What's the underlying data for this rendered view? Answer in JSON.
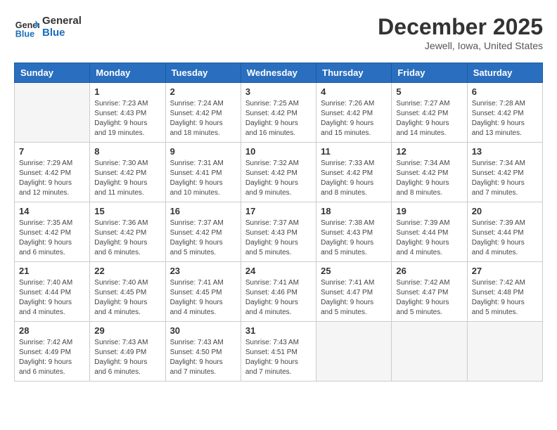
{
  "header": {
    "logo_line1": "General",
    "logo_line2": "Blue",
    "month_title": "December 2025",
    "location": "Jewell, Iowa, United States"
  },
  "weekdays": [
    "Sunday",
    "Monday",
    "Tuesday",
    "Wednesday",
    "Thursday",
    "Friday",
    "Saturday"
  ],
  "weeks": [
    [
      {
        "num": "",
        "info": ""
      },
      {
        "num": "1",
        "info": "Sunrise: 7:23 AM\nSunset: 4:43 PM\nDaylight: 9 hours\nand 19 minutes."
      },
      {
        "num": "2",
        "info": "Sunrise: 7:24 AM\nSunset: 4:42 PM\nDaylight: 9 hours\nand 18 minutes."
      },
      {
        "num": "3",
        "info": "Sunrise: 7:25 AM\nSunset: 4:42 PM\nDaylight: 9 hours\nand 16 minutes."
      },
      {
        "num": "4",
        "info": "Sunrise: 7:26 AM\nSunset: 4:42 PM\nDaylight: 9 hours\nand 15 minutes."
      },
      {
        "num": "5",
        "info": "Sunrise: 7:27 AM\nSunset: 4:42 PM\nDaylight: 9 hours\nand 14 minutes."
      },
      {
        "num": "6",
        "info": "Sunrise: 7:28 AM\nSunset: 4:42 PM\nDaylight: 9 hours\nand 13 minutes."
      }
    ],
    [
      {
        "num": "7",
        "info": "Sunrise: 7:29 AM\nSunset: 4:42 PM\nDaylight: 9 hours\nand 12 minutes."
      },
      {
        "num": "8",
        "info": "Sunrise: 7:30 AM\nSunset: 4:42 PM\nDaylight: 9 hours\nand 11 minutes."
      },
      {
        "num": "9",
        "info": "Sunrise: 7:31 AM\nSunset: 4:41 PM\nDaylight: 9 hours\nand 10 minutes."
      },
      {
        "num": "10",
        "info": "Sunrise: 7:32 AM\nSunset: 4:42 PM\nDaylight: 9 hours\nand 9 minutes."
      },
      {
        "num": "11",
        "info": "Sunrise: 7:33 AM\nSunset: 4:42 PM\nDaylight: 9 hours\nand 8 minutes."
      },
      {
        "num": "12",
        "info": "Sunrise: 7:34 AM\nSunset: 4:42 PM\nDaylight: 9 hours\nand 8 minutes."
      },
      {
        "num": "13",
        "info": "Sunrise: 7:34 AM\nSunset: 4:42 PM\nDaylight: 9 hours\nand 7 minutes."
      }
    ],
    [
      {
        "num": "14",
        "info": "Sunrise: 7:35 AM\nSunset: 4:42 PM\nDaylight: 9 hours\nand 6 minutes."
      },
      {
        "num": "15",
        "info": "Sunrise: 7:36 AM\nSunset: 4:42 PM\nDaylight: 9 hours\nand 6 minutes."
      },
      {
        "num": "16",
        "info": "Sunrise: 7:37 AM\nSunset: 4:42 PM\nDaylight: 9 hours\nand 5 minutes."
      },
      {
        "num": "17",
        "info": "Sunrise: 7:37 AM\nSunset: 4:43 PM\nDaylight: 9 hours\nand 5 minutes."
      },
      {
        "num": "18",
        "info": "Sunrise: 7:38 AM\nSunset: 4:43 PM\nDaylight: 9 hours\nand 5 minutes."
      },
      {
        "num": "19",
        "info": "Sunrise: 7:39 AM\nSunset: 4:44 PM\nDaylight: 9 hours\nand 4 minutes."
      },
      {
        "num": "20",
        "info": "Sunrise: 7:39 AM\nSunset: 4:44 PM\nDaylight: 9 hours\nand 4 minutes."
      }
    ],
    [
      {
        "num": "21",
        "info": "Sunrise: 7:40 AM\nSunset: 4:44 PM\nDaylight: 9 hours\nand 4 minutes."
      },
      {
        "num": "22",
        "info": "Sunrise: 7:40 AM\nSunset: 4:45 PM\nDaylight: 9 hours\nand 4 minutes."
      },
      {
        "num": "23",
        "info": "Sunrise: 7:41 AM\nSunset: 4:45 PM\nDaylight: 9 hours\nand 4 minutes."
      },
      {
        "num": "24",
        "info": "Sunrise: 7:41 AM\nSunset: 4:46 PM\nDaylight: 9 hours\nand 4 minutes."
      },
      {
        "num": "25",
        "info": "Sunrise: 7:41 AM\nSunset: 4:47 PM\nDaylight: 9 hours\nand 5 minutes."
      },
      {
        "num": "26",
        "info": "Sunrise: 7:42 AM\nSunset: 4:47 PM\nDaylight: 9 hours\nand 5 minutes."
      },
      {
        "num": "27",
        "info": "Sunrise: 7:42 AM\nSunset: 4:48 PM\nDaylight: 9 hours\nand 5 minutes."
      }
    ],
    [
      {
        "num": "28",
        "info": "Sunrise: 7:42 AM\nSunset: 4:49 PM\nDaylight: 9 hours\nand 6 minutes."
      },
      {
        "num": "29",
        "info": "Sunrise: 7:43 AM\nSunset: 4:49 PM\nDaylight: 9 hours\nand 6 minutes."
      },
      {
        "num": "30",
        "info": "Sunrise: 7:43 AM\nSunset: 4:50 PM\nDaylight: 9 hours\nand 7 minutes."
      },
      {
        "num": "31",
        "info": "Sunrise: 7:43 AM\nSunset: 4:51 PM\nDaylight: 9 hours\nand 7 minutes."
      },
      {
        "num": "",
        "info": ""
      },
      {
        "num": "",
        "info": ""
      },
      {
        "num": "",
        "info": ""
      }
    ]
  ]
}
